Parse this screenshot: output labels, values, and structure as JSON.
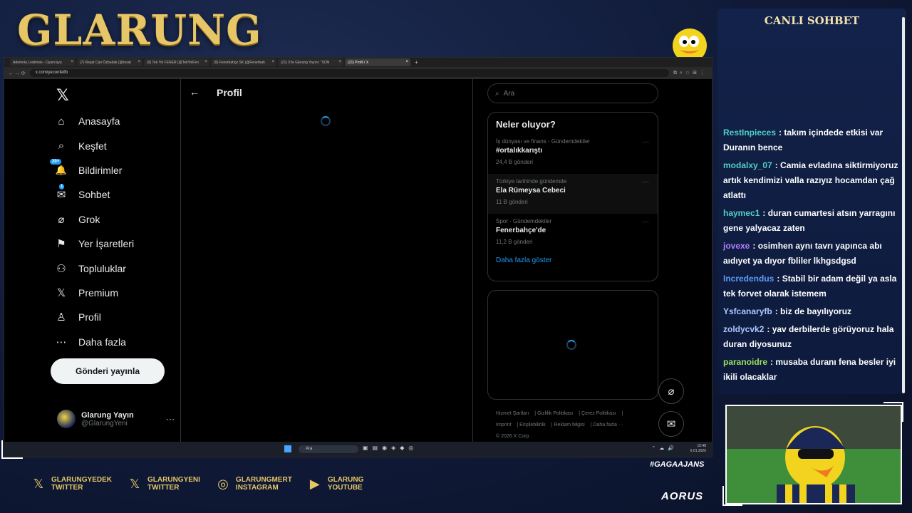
{
  "overlay": {
    "brand": "GLARUNG",
    "chat_title": "CANLI SOHBET",
    "hashtag": "#GAGAAJANS",
    "sponsor": "AORUS",
    "socials": [
      {
        "icon": "x-icon",
        "line1": "GLARUNGYEDEK",
        "line2": "TWITTER"
      },
      {
        "icon": "x-icon",
        "line1": "GLARUNGYENI",
        "line2": "TWITTER"
      },
      {
        "icon": "instagram-icon",
        "line1": "GLARUNGMERT",
        "line2": "INSTAGRAM"
      },
      {
        "icon": "youtube-icon",
        "line1": "GLARUNG",
        "line2": "YOUTUBE"
      }
    ]
  },
  "browser": {
    "tabs": [
      "Ademola Lookman - Oyuncuyu",
      "(7) Reşat Can Özbudak (@resat",
      "(9) Tek Yol FENER (@TekYolFen",
      "(9) Fenerbahçe SK (@Fenerbah",
      "(21) X'te Glarung Yayını: \"SON",
      "(21) Profil / X"
    ],
    "url": "x.com/yeconfetfb"
  },
  "x": {
    "nav": [
      {
        "icon": "home-icon",
        "glyph": "⌂",
        "label": "Anasayfa"
      },
      {
        "icon": "search-icon",
        "glyph": "⌕",
        "label": "Keşfet"
      },
      {
        "icon": "bell-icon",
        "glyph": "🔔",
        "label": "Bildirimler",
        "badge": "20+"
      },
      {
        "icon": "mail-icon",
        "glyph": "✉",
        "label": "Sohbet",
        "badge": "1"
      },
      {
        "icon": "grok-icon",
        "glyph": "⌀",
        "label": "Grok"
      },
      {
        "icon": "bookmark-icon",
        "glyph": "⚑",
        "label": "Yer İşaretleri"
      },
      {
        "icon": "communities-icon",
        "glyph": "⚇",
        "label": "Topluluklar"
      },
      {
        "icon": "premium-icon",
        "glyph": "𝕏",
        "label": "Premium"
      },
      {
        "icon": "profile-icon",
        "glyph": "♙",
        "label": "Profil"
      },
      {
        "icon": "more-icon",
        "glyph": "⋯",
        "label": "Daha fazla"
      }
    ],
    "post_button": "Gönderi yayınla",
    "account": {
      "name": "Glarung Yayın",
      "handle": "@GlarungYeni"
    },
    "center_title": "Profil",
    "search_placeholder": "Ara",
    "trends_title": "Neler oluyor?",
    "trends": [
      {
        "category": "İş dünyası ve finans · Gündemdekiler",
        "name": "#ortalıkkarıştı",
        "count": "24,4 B gönderi"
      },
      {
        "category": "Türkiye tarihinde gündemde",
        "name": "Ela Rümeysa Cebeci",
        "count": "11 B gönderi"
      },
      {
        "category": "Spor · Gündemdekiler",
        "name": "Fenerbahçe'de",
        "count": "11,2 B gönderi"
      }
    ],
    "show_more": "Daha fazla göster",
    "footer": [
      "Hizmet Şartları",
      "Gizlilik Politikası",
      "Çerez Politikası",
      "Imprint",
      "Erişilebilirlik",
      "Reklam bilgisi",
      "Daha fazla ···",
      "© 2026 X Corp."
    ]
  },
  "taskbar": {
    "search": "Ara",
    "time": "15:48",
    "date": "6.01.2026"
  },
  "chat": [
    {
      "user": "RestInpieces",
      "color": "#4fd1c5",
      "text": ": takım içindede etkisi var Duranın bence"
    },
    {
      "user": "modalxy_07",
      "color": "#4fd1c5",
      "text": ": Camia evladına siktirmiyoruz artık kendimizi valla razıyız hocamdan çağ atlattı"
    },
    {
      "user": "haymec1",
      "color": "#4fd1c5",
      "text": ": duran cumartesi atsın yarragını gene yalyacaz zaten"
    },
    {
      "user": "jovexe",
      "color": "#b47cff",
      "text": ": osimhen aynı tavrı yapınca abı aıdıyet ya dıyor fbliler lkhgsdgsd"
    },
    {
      "user": "Incredendus",
      "color": "#5a9bf5",
      "text": ": Stabil bir adam değil ya asla tek forvet olarak istemem"
    },
    {
      "user": "Ysfcanaryfb",
      "color": "#a9c7ff",
      "text": ": biz de bayılıyoruz"
    },
    {
      "user": "zoldycvk2",
      "color": "#a9c7ff",
      "text": ": yav derbilerde görüyoruz hala duran diyosunuz"
    },
    {
      "user": "paranoidre",
      "color": "#9be15d",
      "text": ": musaba duranı fena besler iyi ikili olacaklar"
    }
  ]
}
